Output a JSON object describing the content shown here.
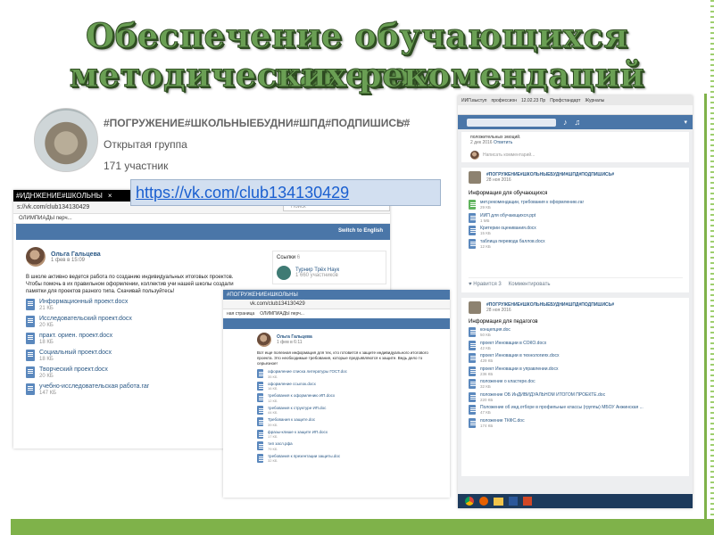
{
  "slide": {
    "title_line1": "Обеспечение обучающихся пакетом",
    "title_line2": "методических рекомендаций",
    "link": "https://vk.com/club134130429"
  },
  "group_card": {
    "hashtags": "#ПОГРУЖЕНИЕ#ШКОЛЬНЫЕБУДНИ#ШПД#ПОДПИШИСЬ#",
    "type": "Открытая группа",
    "members": "171 участник",
    "more": "•••"
  },
  "browser_left": {
    "tab": "#ИДНЖЕНИЕ#ШКОЛЬНЫ",
    "tab_close": "×",
    "tab_add": "+",
    "url": "s://vk.com/club134130429",
    "search": "Поиск",
    "bookmark": "ОЛИМПИАДЫ перч...",
    "switch_english": "Switch to English",
    "post_author": "Ольга Гальцева",
    "post_date": "1 фев в 15:09",
    "post_text": "В школе активно ведется работа по созданию индивидуальных итоговых проектов. Чтобы помочь в их правильном оформлении, коллектив учи нашей школы создали памятки для проектов разного типа. Скачивай пользуйтесь!",
    "links_title": "Ссылки",
    "links_count": "6",
    "link_item_name": "Турнир Трёх Наук",
    "link_item_members": "1 660 участников",
    "docs": [
      {
        "name": "Информационный проект.docx",
        "size": "21 КБ"
      },
      {
        "name": "Исследовательский проект.docx",
        "size": "20 КБ"
      },
      {
        "name": "практ. ориен. проект.docx",
        "size": "18 КБ"
      },
      {
        "name": "Социальный проект.docx",
        "size": "18 КБ"
      },
      {
        "name": "Творческий проект.docx",
        "size": "20 КБ"
      },
      {
        "name": "учебно-исследовательская работа.rar",
        "size": "147 КБ"
      }
    ]
  },
  "browser_mid": {
    "tab": "#ПОГРУЖЕНИЕ#ШКОЛЬНЫ",
    "url": "vk.com/club134130429",
    "bookmark_left": "ная страница",
    "bookmark": "ОЛИМПИАДЫ перч...",
    "post_author": "Ольга Гальцева",
    "post_date": "1 фев в 6:11",
    "post_text": "Вот еще полезная информация для тех, кто готовится к защите индивидуального итогового проекта. Это необходимые требования, которые предъявляются к защите. Ведь дело то серьезное!",
    "docs": [
      {
        "name": "оформление списка литературы ГОСТ.doc",
        "size": "35 КБ"
      },
      {
        "name": "оформление ссылок.docx",
        "size": "16 КБ"
      },
      {
        "name": "требования к оформлению ИП.docx",
        "size": "12 КБ"
      },
      {
        "name": "требования к структуре ИП.doc",
        "size": "44 КБ"
      },
      {
        "name": "Требования к защите.doc",
        "size": "39 КБ"
      },
      {
        "name": "фразы-клише к защите ИП.docx",
        "size": "17 КБ"
      },
      {
        "name": "тип засл.рфа",
        "size": "79 КБ"
      },
      {
        "name": "требования к презентации защиты.doc",
        "size": "32 КБ"
      }
    ]
  },
  "browser_right": {
    "tabs": [
      "ИИП.выступ",
      "профессион",
      "12.02.23 Пр",
      "Профстандарт",
      "Журналы"
    ],
    "comment_text": "положительных эмоций.",
    "comment_date": "2 дек 2016",
    "comment_reply": "Ответить",
    "write_comment": "Написать комментарий...",
    "post1": {
      "group": "#ПОГРУЖЕНИЕ#ШКОЛЬНЫЕБУДНИ#ШПД#ПОДПИШИСЬ#",
      "date": "28 ноя 2016",
      "heading": "Информация для обучающихся",
      "docs": [
        {
          "name": "мет.рекомендации, требования к оформлению.rar",
          "size": "29 КБ",
          "green": true
        },
        {
          "name": "ИИП для обучающихся.ppt",
          "size": "1 МБ",
          "green": false
        },
        {
          "name": "Критерии оценивания.docx",
          "size": "15 КБ",
          "green": false
        },
        {
          "name": "таблица перевода баллов.docx",
          "size": "12 КБ",
          "green": false
        }
      ],
      "likes_label": "Нравится",
      "likes": "3",
      "comment_label": "Комментировать"
    },
    "post2": {
      "group": "#ПОГРУЖЕНИЕ#ШКОЛЬНЫЕБУДНИ#ШПД#ПОДПИШИСЬ#",
      "date": "28 ноя 2016",
      "heading": "Информация для педагогов",
      "docs": [
        {
          "name": "концепция.doc",
          "size": "50 КБ"
        },
        {
          "name": "проект Инновации в СОКО.docx",
          "size": "42 КБ"
        },
        {
          "name": "проект Инновации в технологиях.docx",
          "size": "429 КБ"
        },
        {
          "name": "проект Инновации в управлении.docx",
          "size": "236 КБ"
        },
        {
          "name": "положение о кластере.doc",
          "size": "32 КБ"
        },
        {
          "name": "положение ОБ ИнДИВИДУАЛЬНОМ ИТОГОМ ПРОЕКТЕ.doc",
          "size": "220 КБ"
        },
        {
          "name": "Положение об инд.отборе в профильные классы (группы) МБОУ Анжинская ...",
          "size": "47 КБ"
        },
        {
          "name": "положение ТКФС.doc",
          "size": "174 КБ"
        }
      ]
    }
  },
  "colors": {
    "title_fill": "#6a9f54",
    "title_outline": "#2f4d22",
    "accent_green": "#7fb24a",
    "vk_blue": "#4a76a8",
    "link_blue": "#1a5fd0"
  },
  "icons": [
    "music-note-icon",
    "bell-icon",
    "search-icon",
    "doc-icon",
    "chevron-down-icon",
    "heart-icon",
    "chrome-icon",
    "firefox-icon",
    "folder-icon",
    "word-icon",
    "powerpoint-icon"
  ]
}
